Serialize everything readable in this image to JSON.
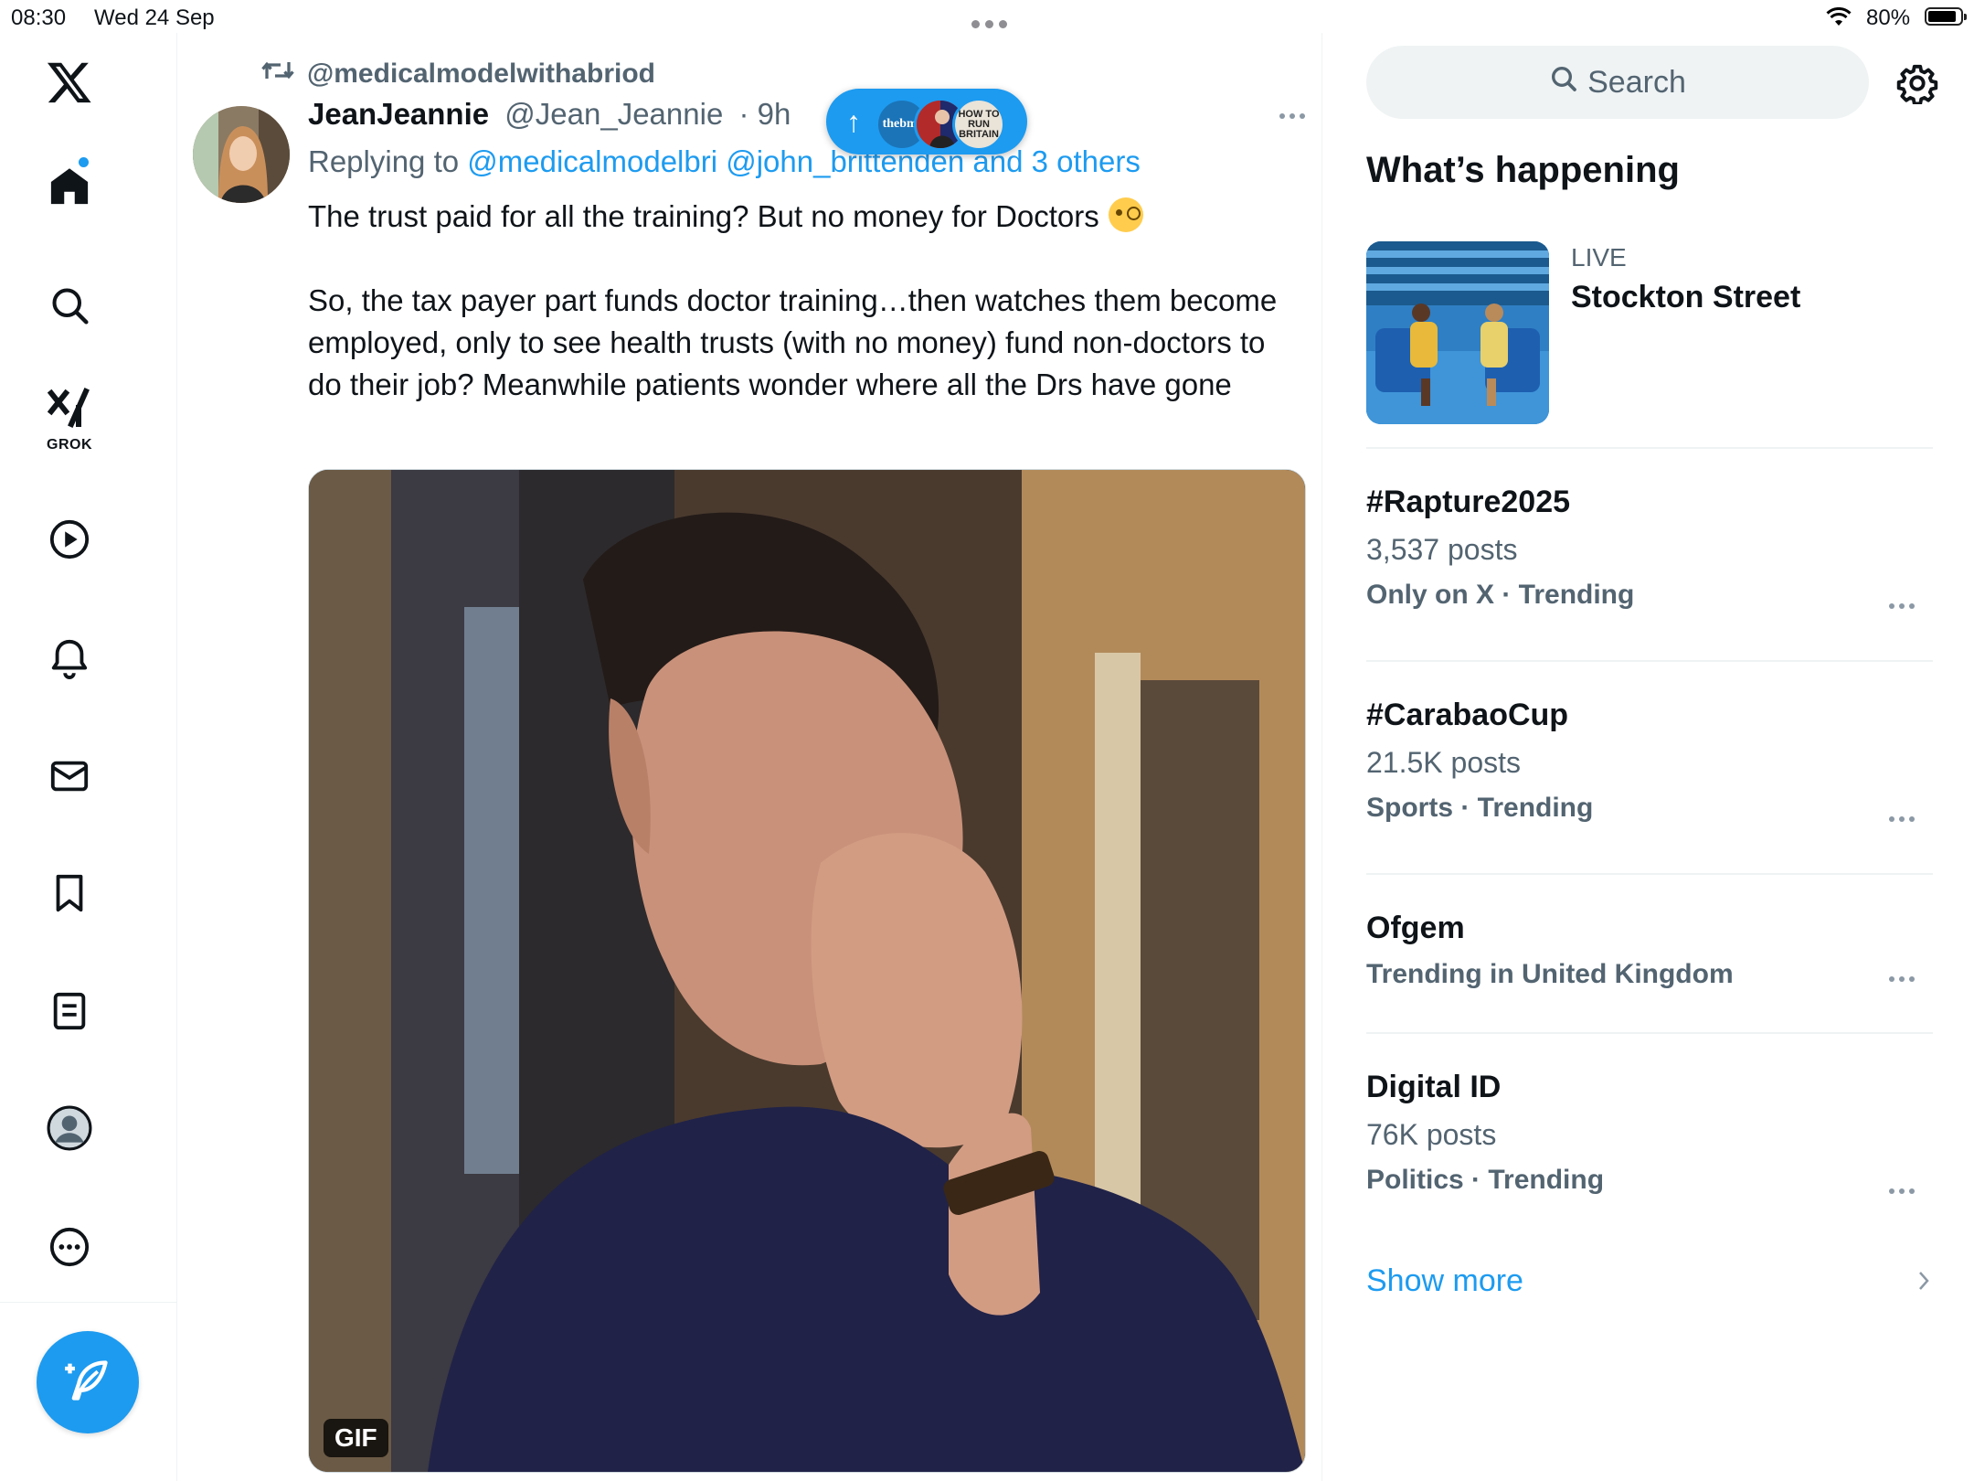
{
  "status_bar": {
    "time": "08:30",
    "date": "Wed 24 Sep",
    "battery": "80%",
    "battery_level": 0.8
  },
  "nav": {
    "items": [
      "x-logo",
      "home",
      "explore",
      "grok",
      "video",
      "notifications",
      "messages",
      "bookmarks",
      "lists",
      "profile",
      "more"
    ],
    "grok_label": "GROK",
    "accent": "#1d9bf0"
  },
  "post": {
    "repost_by": "@medicalmodelwithabriod",
    "author_name": "JeanJeannie",
    "author_handle": "@Jean_Jeannie",
    "age": "9h",
    "reply_prefix": "Replying to",
    "reply_to": "@medicalmodelbri @john_brittenden and 3 others",
    "text_line1": "The trust paid for all the training? But no money for Doctors",
    "text_body": "So, the tax payer part funds doctor training…then watches them become employed, only to see health trusts (with no money) fund non-doctors to do their job? Meanwhile patients wonder where all the Drs have gone",
    "media_badge": "GIF"
  },
  "new_posts_pill": {
    "avatar1_text": "thebmj",
    "avatar3_text": "HOW TO RUN BRITAIN"
  },
  "sidebar": {
    "search_placeholder": "Search",
    "section_title": "What’s happening",
    "live": {
      "label": "LIVE",
      "title": "Stockton Street"
    },
    "trends": [
      {
        "name": "#Rapture2025",
        "posts": "3,537 posts",
        "category": "Only on X · Trending"
      },
      {
        "name": "#CarabaoCup",
        "posts": "21.5K posts",
        "category": "Sports · Trending"
      },
      {
        "name": "Ofgem",
        "posts": "",
        "category": "Trending in United Kingdom"
      },
      {
        "name": "Digital ID",
        "posts": "76K posts",
        "category": "Politics · Trending"
      }
    ],
    "show_more": "Show more"
  }
}
